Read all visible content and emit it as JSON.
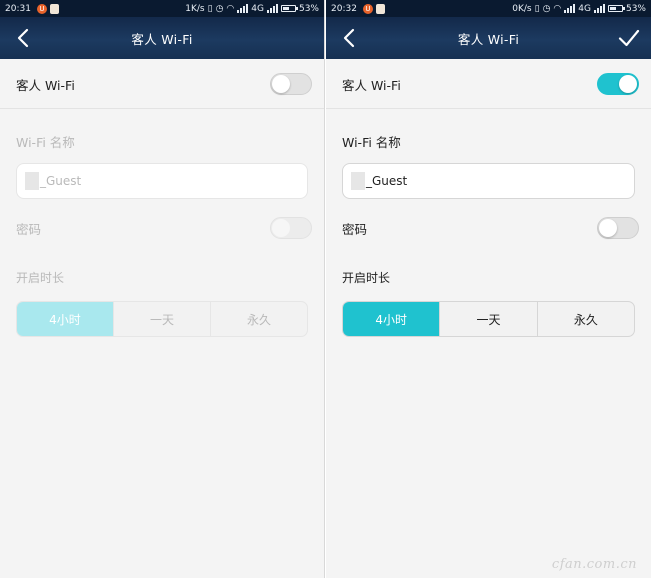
{
  "colors": {
    "accent": "#1fc2cf",
    "accent_disabled": "#a9e8ee",
    "header_bg": "#1c3a60",
    "status_bg": "#0a1a30",
    "page_bg": "#f4f4f4"
  },
  "screens": [
    {
      "status": {
        "time": "20:31",
        "net_speed": "1K/s",
        "network": "4G",
        "battery": "53%"
      },
      "header": {
        "title": "客人 Wi-Fi"
      },
      "guest_wifi": {
        "label": "客人 Wi-Fi",
        "enabled": false
      },
      "wifi_name": {
        "label": "Wi-Fi 名称",
        "value": "_Guest"
      },
      "password": {
        "label": "密码",
        "enabled": false
      },
      "duration": {
        "label": "开启时长",
        "options": [
          "4小时",
          "一天",
          "永久"
        ],
        "selected": "4小时"
      }
    },
    {
      "status": {
        "time": "20:32",
        "net_speed": "0K/s",
        "network": "4G",
        "battery": "53%"
      },
      "header": {
        "title": "客人 Wi-Fi"
      },
      "guest_wifi": {
        "label": "客人 Wi-Fi",
        "enabled": true
      },
      "wifi_name": {
        "label": "Wi-Fi 名称",
        "value": "_Guest"
      },
      "password": {
        "label": "密码",
        "enabled": false
      },
      "duration": {
        "label": "开启时长",
        "options": [
          "4小时",
          "一天",
          "永久"
        ],
        "selected": "4小时"
      }
    }
  ],
  "watermark": "cfan.com.cn",
  "icons": {
    "back": "chevron-left-icon",
    "confirm": "checkmark-icon",
    "wifi": "wifi-icon",
    "alarm": "alarm-clock-icon",
    "vibrate": "vibrate-icon",
    "signal": "signal-bars-icon",
    "battery": "battery-icon"
  }
}
